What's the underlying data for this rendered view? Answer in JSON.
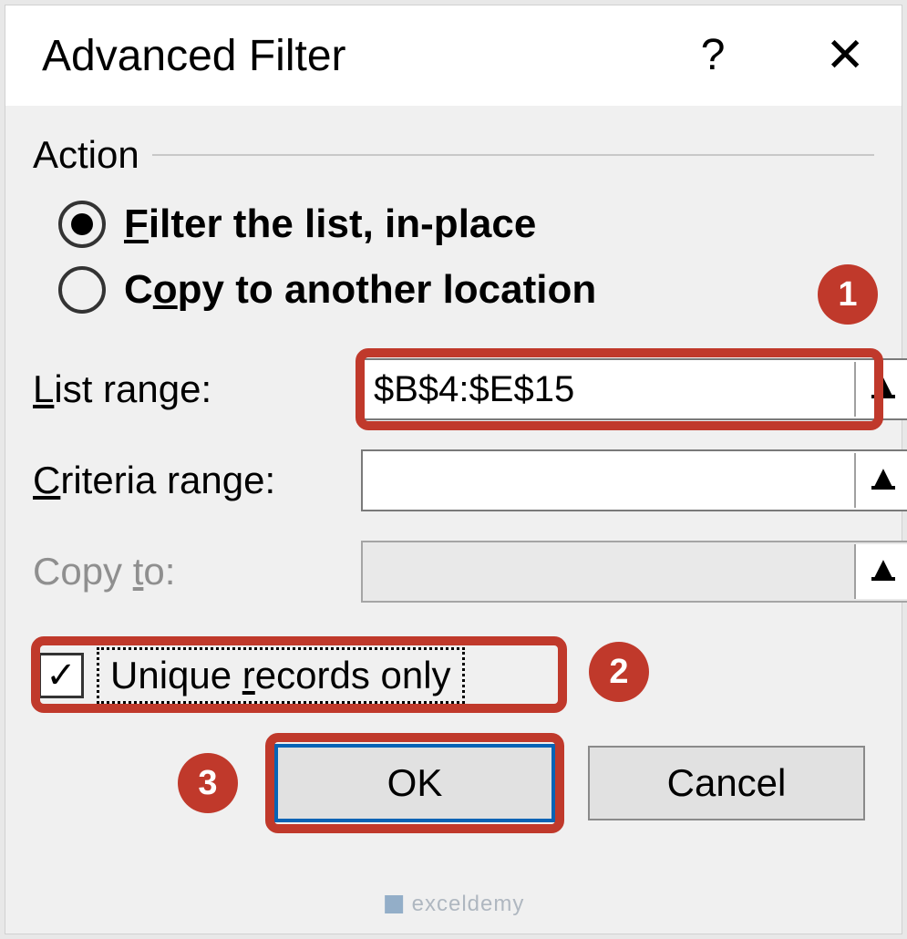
{
  "title": "Advanced Filter",
  "action": {
    "group_label": "Action",
    "options": [
      {
        "label": "Filter the list, in-place",
        "accel": "F",
        "rest": "ilter the list, in-place",
        "selected": true
      },
      {
        "label": "Copy to another location",
        "accel": "o",
        "pre": "C",
        "rest": "py to another location",
        "selected": false
      }
    ]
  },
  "fields": {
    "list_range": {
      "label_pre": "",
      "accel": "L",
      "label_rest": "ist range:",
      "value": "$B$4:$E$15",
      "enabled": true
    },
    "criteria_range": {
      "label_pre": "",
      "accel": "C",
      "label_rest": "riteria range:",
      "value": "",
      "enabled": true
    },
    "copy_to": {
      "label_pre": "Copy ",
      "accel": "t",
      "label_rest": "o:",
      "value": "",
      "enabled": false
    }
  },
  "unique": {
    "label_pre": "Unique ",
    "accel": "r",
    "label_rest": "ecords only",
    "checked": true
  },
  "buttons": {
    "ok": "OK",
    "cancel": "Cancel"
  },
  "callouts": {
    "one": "1",
    "two": "2",
    "three": "3"
  },
  "watermark": "exceldemy"
}
